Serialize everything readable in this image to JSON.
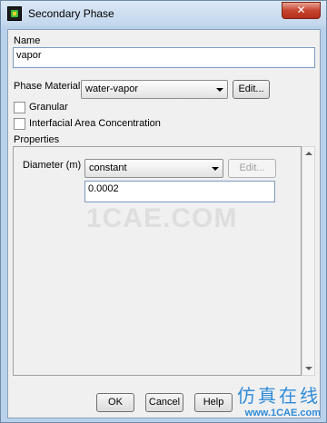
{
  "window": {
    "title": "Secondary Phase",
    "close_glyph": "✕"
  },
  "name": {
    "label": "Name",
    "value": "vapor"
  },
  "phase_material": {
    "label": "Phase Material",
    "selected": "water-vapor",
    "edit_label": "Edit..."
  },
  "options": {
    "granular": {
      "label": "Granular",
      "checked": false
    },
    "interfacial": {
      "label": "Interfacial Area Concentration",
      "checked": false
    }
  },
  "properties": {
    "label": "Properties",
    "diameter": {
      "label": "Diameter (m)",
      "method": "constant",
      "edit_label": "Edit...",
      "value": "0.0002"
    }
  },
  "footer": {
    "ok_label": "OK",
    "cancel_label": "Cancel",
    "help_label": "Help"
  },
  "watermark": {
    "text": "1CAE.COM",
    "cn_text": "仿真在线",
    "url": "www.1CAE.com"
  },
  "colors": {
    "title_bg": "#c2d6ec",
    "close_red": "#c7452f",
    "watermark_blue": "#2e8bd8"
  },
  "icons": {
    "app": "fluent-app-icon",
    "close": "close-icon",
    "dropdown": "chevron-down-icon"
  }
}
